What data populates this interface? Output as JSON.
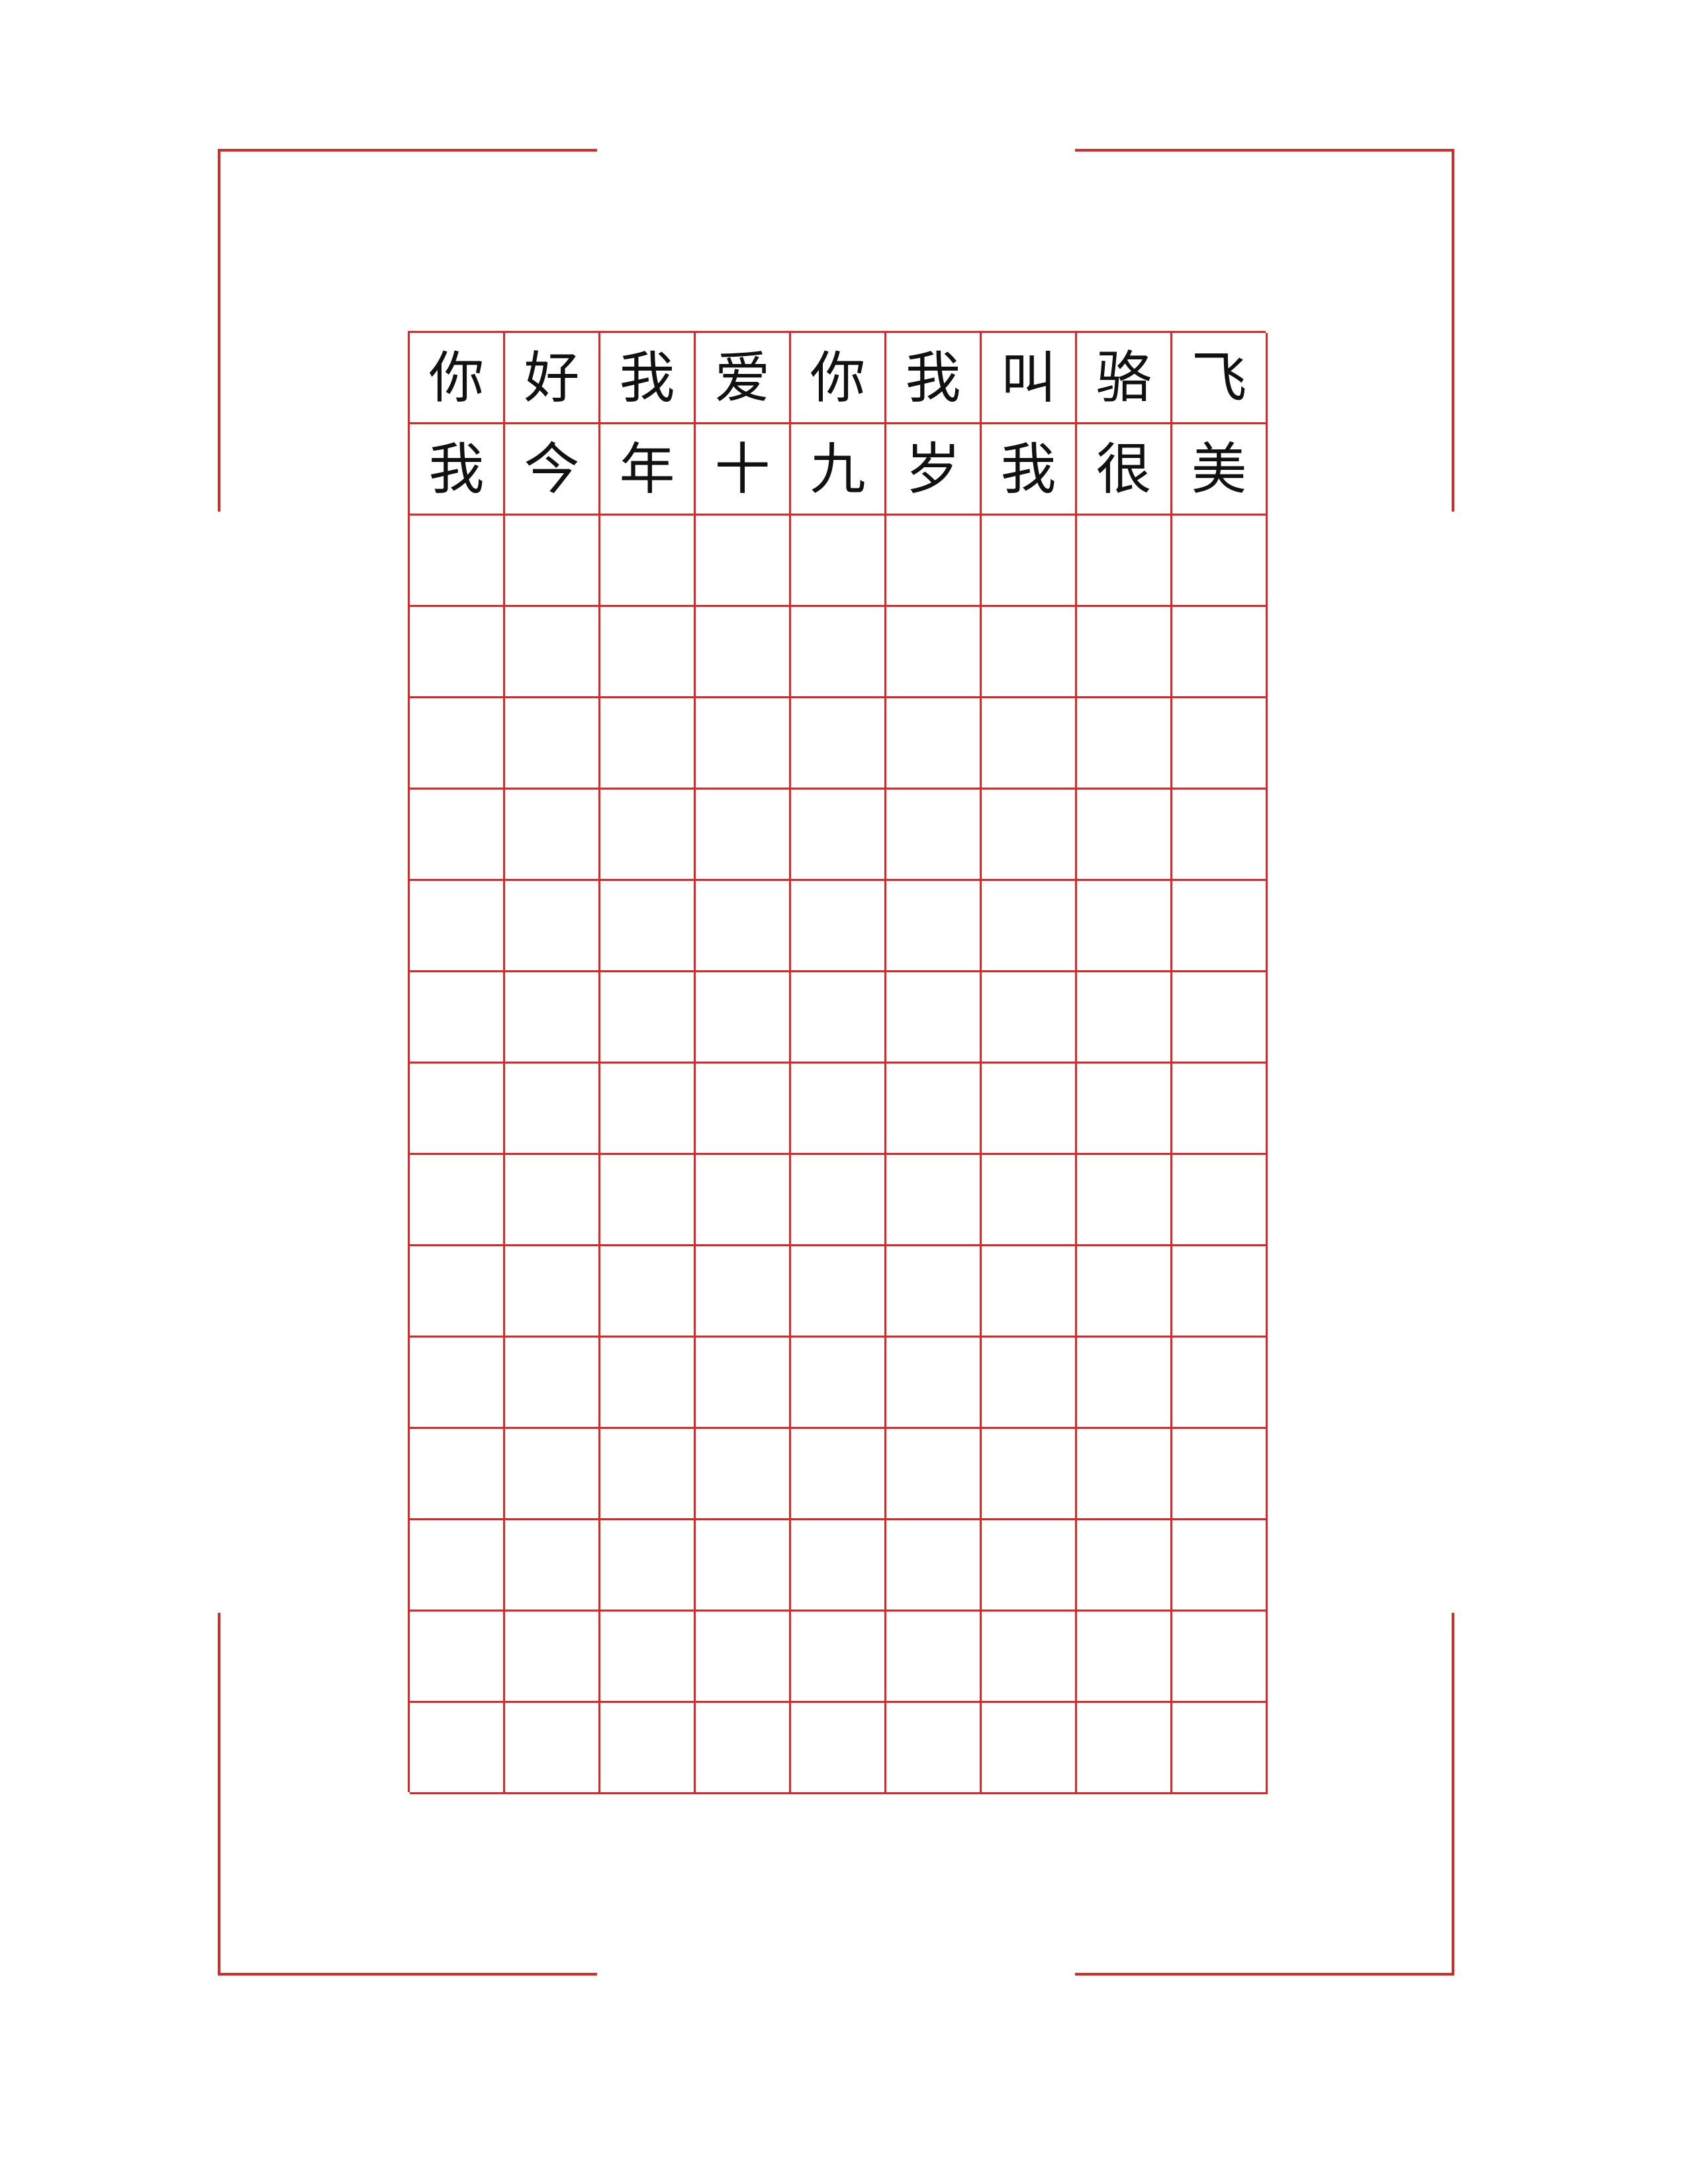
{
  "colors": {
    "grid_line": "#d42a2a",
    "text": "#111111",
    "background": "#ffffff"
  },
  "grid": {
    "columns": 9,
    "rows": 16,
    "characters": [
      [
        "你",
        "好",
        "我",
        "爱",
        "你",
        "我",
        "叫",
        "骆",
        "飞"
      ],
      [
        "我",
        "今",
        "年",
        "十",
        "九",
        "岁",
        "我",
        "很",
        "美"
      ]
    ]
  }
}
